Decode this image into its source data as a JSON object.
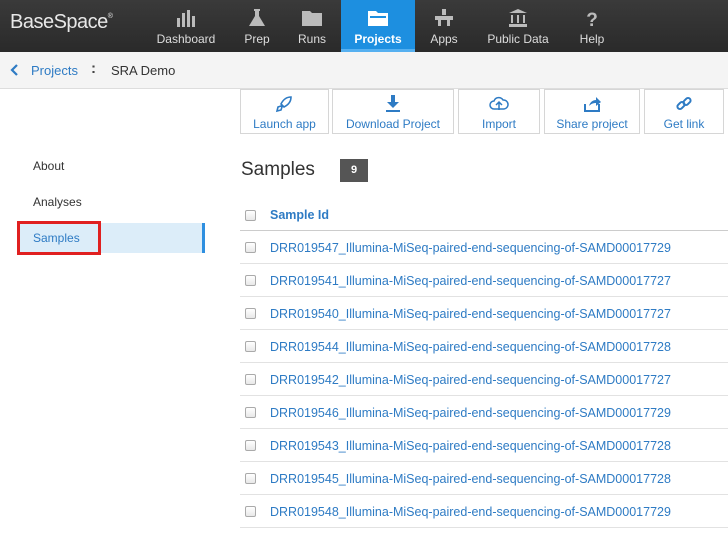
{
  "header": {
    "logo": "BaseSpace",
    "logo_mark": "®",
    "nav": [
      {
        "label": "Dashboard",
        "icon": "bar-chart-icon"
      },
      {
        "label": "Prep",
        "icon": "flask-icon"
      },
      {
        "label": "Runs",
        "icon": "folder-icon"
      },
      {
        "label": "Projects",
        "icon": "open-folder-icon",
        "active": true
      },
      {
        "label": "Apps",
        "icon": "apps-icon"
      },
      {
        "label": "Public Data",
        "icon": "bank-icon"
      },
      {
        "label": "Help",
        "icon": "question-icon"
      }
    ]
  },
  "breadcrumb": {
    "parent": "Projects",
    "separator": ":",
    "current": "SRA Demo"
  },
  "actions": [
    {
      "label": "Launch app",
      "icon": "rocket-icon"
    },
    {
      "label": "Download Project",
      "icon": "download-icon"
    },
    {
      "label": "Import",
      "icon": "cloud-upload-icon"
    },
    {
      "label": "Share project",
      "icon": "share-icon"
    },
    {
      "label": "Get link",
      "icon": "link-icon"
    }
  ],
  "sidebar": {
    "items": [
      {
        "label": "About"
      },
      {
        "label": "Analyses"
      },
      {
        "label": "Samples",
        "active": true
      }
    ]
  },
  "main": {
    "title": "Samples",
    "count": "9",
    "column_header": "Sample Id",
    "rows": [
      "DRR019547_Illumina-MiSeq-paired-end-sequencing-of-SAMD00017729",
      "DRR019541_Illumina-MiSeq-paired-end-sequencing-of-SAMD00017727",
      "DRR019540_Illumina-MiSeq-paired-end-sequencing-of-SAMD00017727",
      "DRR019544_Illumina-MiSeq-paired-end-sequencing-of-SAMD00017728",
      "DRR019542_Illumina-MiSeq-paired-end-sequencing-of-SAMD00017727",
      "DRR019546_Illumina-MiSeq-paired-end-sequencing-of-SAMD00017729",
      "DRR019543_Illumina-MiSeq-paired-end-sequencing-of-SAMD00017728",
      "DRR019545_Illumina-MiSeq-paired-end-sequencing-of-SAMD00017728",
      "DRR019548_Illumina-MiSeq-paired-end-sequencing-of-SAMD00017729"
    ]
  },
  "colors": {
    "accent": "#1d8fe0",
    "link": "#2e7bc4",
    "highlight_box": "#e02020"
  }
}
